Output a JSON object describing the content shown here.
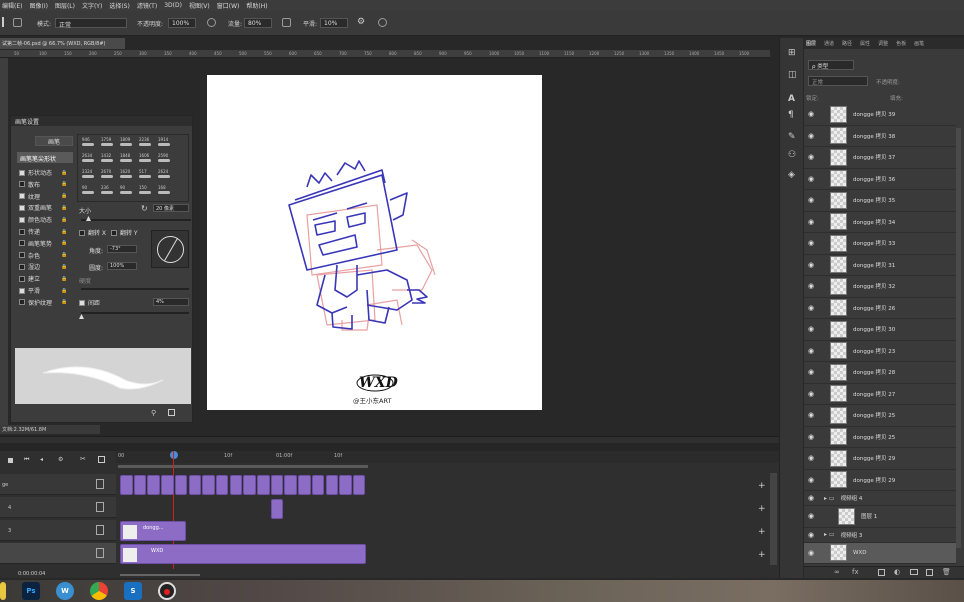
{
  "menu": [
    "编辑(E)",
    "图像(I)",
    "图层(L)",
    "文字(Y)",
    "选择(S)",
    "滤镜(T)",
    "3D(D)",
    "视图(V)",
    "窗口(W)",
    "帮助(H)"
  ],
  "options": {
    "mode_label": "模式:",
    "mode_value": "正常",
    "opacity_label": "不透明度:",
    "opacity_value": "100%",
    "flow_label": "流量:",
    "flow_value": "80%",
    "smoothing_label": "平滑:",
    "smoothing_value": "10%"
  },
  "document": {
    "tab_title": "试第二帧-06.psd @ 66.7% (WXD, RGB/8#)",
    "status": "文档:2.32M/61.8M",
    "signature": "@王小东ART"
  },
  "ruler_ticks": [
    "50",
    "100",
    "150",
    "200",
    "250",
    "300",
    "350",
    "400",
    "450",
    "500",
    "550",
    "600",
    "650",
    "700",
    "750",
    "800",
    "850",
    "900",
    "950",
    "1000",
    "1050",
    "1100",
    "1150",
    "1200",
    "1250",
    "1300",
    "1350",
    "1400",
    "1450",
    "1500"
  ],
  "brush_panel": {
    "title": "画笔设置",
    "preset_button": "画笔",
    "tip_shape": "画笔笔尖形状",
    "options": [
      {
        "label": "形状动态",
        "checked": true
      },
      {
        "label": "散布",
        "checked": false
      },
      {
        "label": "纹理",
        "checked": true
      },
      {
        "label": "双重画笔",
        "checked": true
      },
      {
        "label": "颜色动态",
        "checked": true
      },
      {
        "label": "传递",
        "checked": false
      },
      {
        "label": "画笔笔势",
        "checked": false
      },
      {
        "label": "杂色",
        "checked": false
      },
      {
        "label": "湿边",
        "checked": false
      },
      {
        "label": "建立",
        "checked": false
      },
      {
        "label": "平滑",
        "checked": true
      },
      {
        "label": "保护纹理",
        "checked": false
      }
    ],
    "tip_sizes_row1": [
      "946",
      "1759",
      "1809",
      "2236",
      "1914"
    ],
    "tip_sizes_row2": [
      "2634",
      "1432",
      "1848",
      "1606",
      "2590"
    ],
    "tip_sizes_row3": [
      "2324",
      "2670",
      "1620",
      "517",
      "2624"
    ],
    "tip_sizes_row4": [
      "90",
      "236",
      "90",
      "150",
      "168"
    ],
    "size_label": "大小",
    "size_value": "20 像素",
    "flip_x": "翻转 X",
    "flip_y": "翻转 Y",
    "angle_label": "角度:",
    "angle_value": "-73°",
    "roundness_label": "圆度:",
    "roundness_value": "100%",
    "hardness_label": "硬度",
    "spacing_label": "间距",
    "spacing_value": "4%"
  },
  "layers_panel": {
    "tabs": [
      "图层",
      "通道",
      "路径",
      "属性",
      "调整",
      "色板",
      "画笔"
    ],
    "filter_label": "ρ 类型",
    "blend_mode": "正常",
    "opacity_label": "不透明度:",
    "lock_label": "锁定:",
    "fill_label": "填充:",
    "layers": [
      "dongge 拷贝 39",
      "dongge 拷贝 38",
      "dongge 拷贝 37",
      "dongge 拷贝 36",
      "dongge 拷贝 35",
      "dongge 拷贝 34",
      "dongge 拷贝 33",
      "dongge 拷贝 31",
      "dongge 拷贝 32",
      "dongge 拷贝 26",
      "dongge 拷贝 30",
      "dongge 拷贝 23",
      "dongge 拷贝 28",
      "dongge 拷贝 27",
      "dongge 拷贝 25",
      "dongge 拷贝 25",
      "dongge 拷贝 29",
      "dongge 拷贝 29"
    ],
    "group4": "视频组 4",
    "group4_layer": "图层 1",
    "group3": "视频组 3",
    "selected_layer": "WXD"
  },
  "timeline": {
    "time_markers": [
      "00",
      "10f",
      "01:00f",
      "10f"
    ],
    "current_time": "0:00:00:04",
    "tracks": [
      "ge",
      "4",
      "3",
      ""
    ],
    "clip_dongge": "dongg...",
    "clip_wxd": "WXD"
  },
  "taskbar": {
    "apps": [
      "Ps",
      "W",
      "S"
    ]
  }
}
